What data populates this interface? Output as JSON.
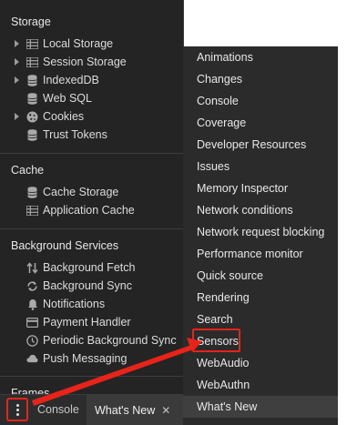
{
  "storage": {
    "title": "Storage",
    "items": [
      {
        "label": "Local Storage",
        "icon": "grid-icon",
        "expandable": true
      },
      {
        "label": "Session Storage",
        "icon": "grid-icon",
        "expandable": true
      },
      {
        "label": "IndexedDB",
        "icon": "database-icon",
        "expandable": true
      },
      {
        "label": "Web SQL",
        "icon": "database-icon",
        "expandable": false
      },
      {
        "label": "Cookies",
        "icon": "cookie-icon",
        "expandable": true
      },
      {
        "label": "Trust Tokens",
        "icon": "database-icon",
        "expandable": false
      }
    ]
  },
  "cache": {
    "title": "Cache",
    "items": [
      {
        "label": "Cache Storage",
        "icon": "database-icon"
      },
      {
        "label": "Application Cache",
        "icon": "grid-icon"
      }
    ]
  },
  "background_services": {
    "title": "Background Services",
    "items": [
      {
        "label": "Background Fetch",
        "icon": "arrows-updown-icon"
      },
      {
        "label": "Background Sync",
        "icon": "sync-icon"
      },
      {
        "label": "Notifications",
        "icon": "bell-icon"
      },
      {
        "label": "Payment Handler",
        "icon": "card-icon"
      },
      {
        "label": "Periodic Background Sync",
        "icon": "clock-icon"
      },
      {
        "label": "Push Messaging",
        "icon": "cloud-icon"
      }
    ]
  },
  "frames": {
    "title": "Frames"
  },
  "drawer": {
    "tabs": [
      {
        "label": "Console"
      },
      {
        "label": "What's New",
        "close": "✕"
      }
    ]
  },
  "menu": {
    "items": [
      "Animations",
      "Changes",
      "Console",
      "Coverage",
      "Developer Resources",
      "Issues",
      "Memory Inspector",
      "Network conditions",
      "Network request blocking",
      "Performance monitor",
      "Quick source",
      "Rendering",
      "Search",
      "Sensors",
      "WebAudio",
      "WebAuthn",
      "What's New"
    ],
    "highlighted": "Sensors",
    "active": "What's New"
  },
  "colors": {
    "panel_bg": "#242424",
    "menu_bg": "#2b2b2b",
    "annotation": "#e8231a"
  }
}
